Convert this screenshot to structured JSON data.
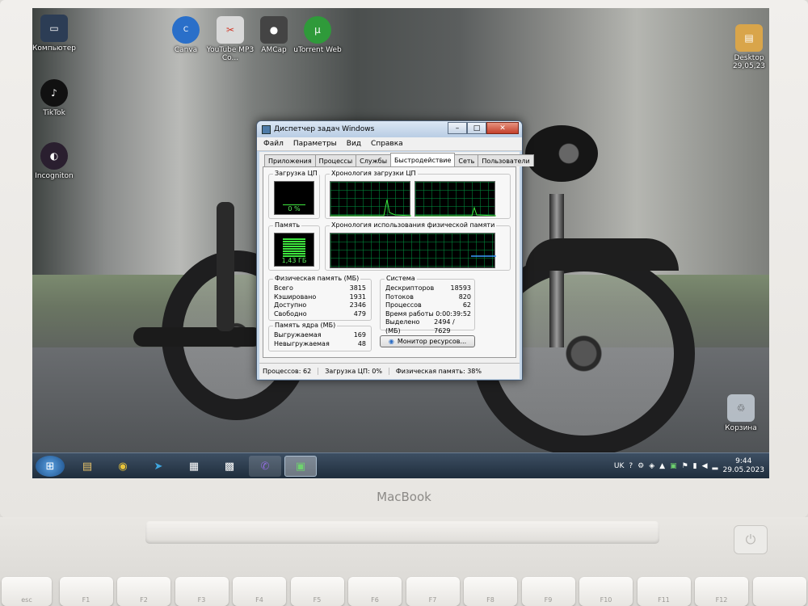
{
  "laptop": {
    "brand": "MacBook"
  },
  "desktop": {
    "icons_left": [
      {
        "label": "Компьютер",
        "icon": "computer-icon"
      },
      {
        "label": "TikTok",
        "icon": "tiktok-icon"
      },
      {
        "label": "Incogniton",
        "icon": "incogniton-icon"
      }
    ],
    "icons_top": [
      {
        "label": "Canva",
        "icon": "canva-icon",
        "color": "#2a6fc9"
      },
      {
        "label": "YouTube MP3 Co...",
        "icon": "scissors-icon",
        "color": "#d23a2a"
      },
      {
        "label": "AMCap",
        "icon": "camera-icon",
        "color": "#444444"
      },
      {
        "label": "uTorrent Web",
        "icon": "utorrent-icon",
        "color": "#2f9a3a"
      }
    ],
    "folder": {
      "label": "Desktop",
      "sub": "29,05,23"
    },
    "recycle": {
      "label": "Корзина"
    }
  },
  "taskbar": {
    "start": "⊞",
    "lang": "UK",
    "time": "9:44",
    "date": "29.05.2023"
  },
  "taskmgr": {
    "title": "Диспетчер задач Windows",
    "menu": [
      "Файл",
      "Параметры",
      "Вид",
      "Справка"
    ],
    "tabs": [
      "Приложения",
      "Процессы",
      "Службы",
      "Быстродействие",
      "Сеть",
      "Пользователи"
    ],
    "active_tab": 3,
    "cpu_label": "Загрузка ЦП",
    "cpu_value": "0 %",
    "cpu_history_label": "Хронология загрузки ЦП",
    "mem_label": "Память",
    "mem_value": "1,43 ГБ",
    "mem_history_label": "Хронология использования физической памяти",
    "phys": {
      "title": "Физическая память (МБ)",
      "rows": [
        {
          "k": "Всего",
          "v": "3815"
        },
        {
          "k": "Кэшировано",
          "v": "1931"
        },
        {
          "k": "Доступно",
          "v": "2346"
        },
        {
          "k": "Свободно",
          "v": "479"
        }
      ]
    },
    "kernel": {
      "title": "Память ядра (МБ)",
      "rows": [
        {
          "k": "Выгружаемая",
          "v": "169"
        },
        {
          "k": "Невыгружаемая",
          "v": "48"
        }
      ]
    },
    "system": {
      "title": "Система",
      "rows": [
        {
          "k": "Дескрипторов",
          "v": "18593"
        },
        {
          "k": "Потоков",
          "v": "820"
        },
        {
          "k": "Процессов",
          "v": "62"
        },
        {
          "k": "Время работы",
          "v": "0:00:39:52"
        },
        {
          "k": "Выделено (МБ)",
          "v": "2494 / 7629"
        }
      ]
    },
    "resmon_button": "Монитор ресурсов...",
    "status": {
      "processes": "Процессов: 62",
      "cpu": "Загрузка ЦП: 0%",
      "memory": "Физическая память: 38%"
    },
    "cpu_load_fraction": 0.0,
    "mem_load_fraction": 0.38
  },
  "keyboard": {
    "keys": [
      "esc",
      "F1",
      "F2",
      "F3",
      "F4",
      "F5",
      "F6",
      "F7",
      "F8",
      "F9",
      "F10",
      "F11",
      "F12",
      ""
    ]
  }
}
